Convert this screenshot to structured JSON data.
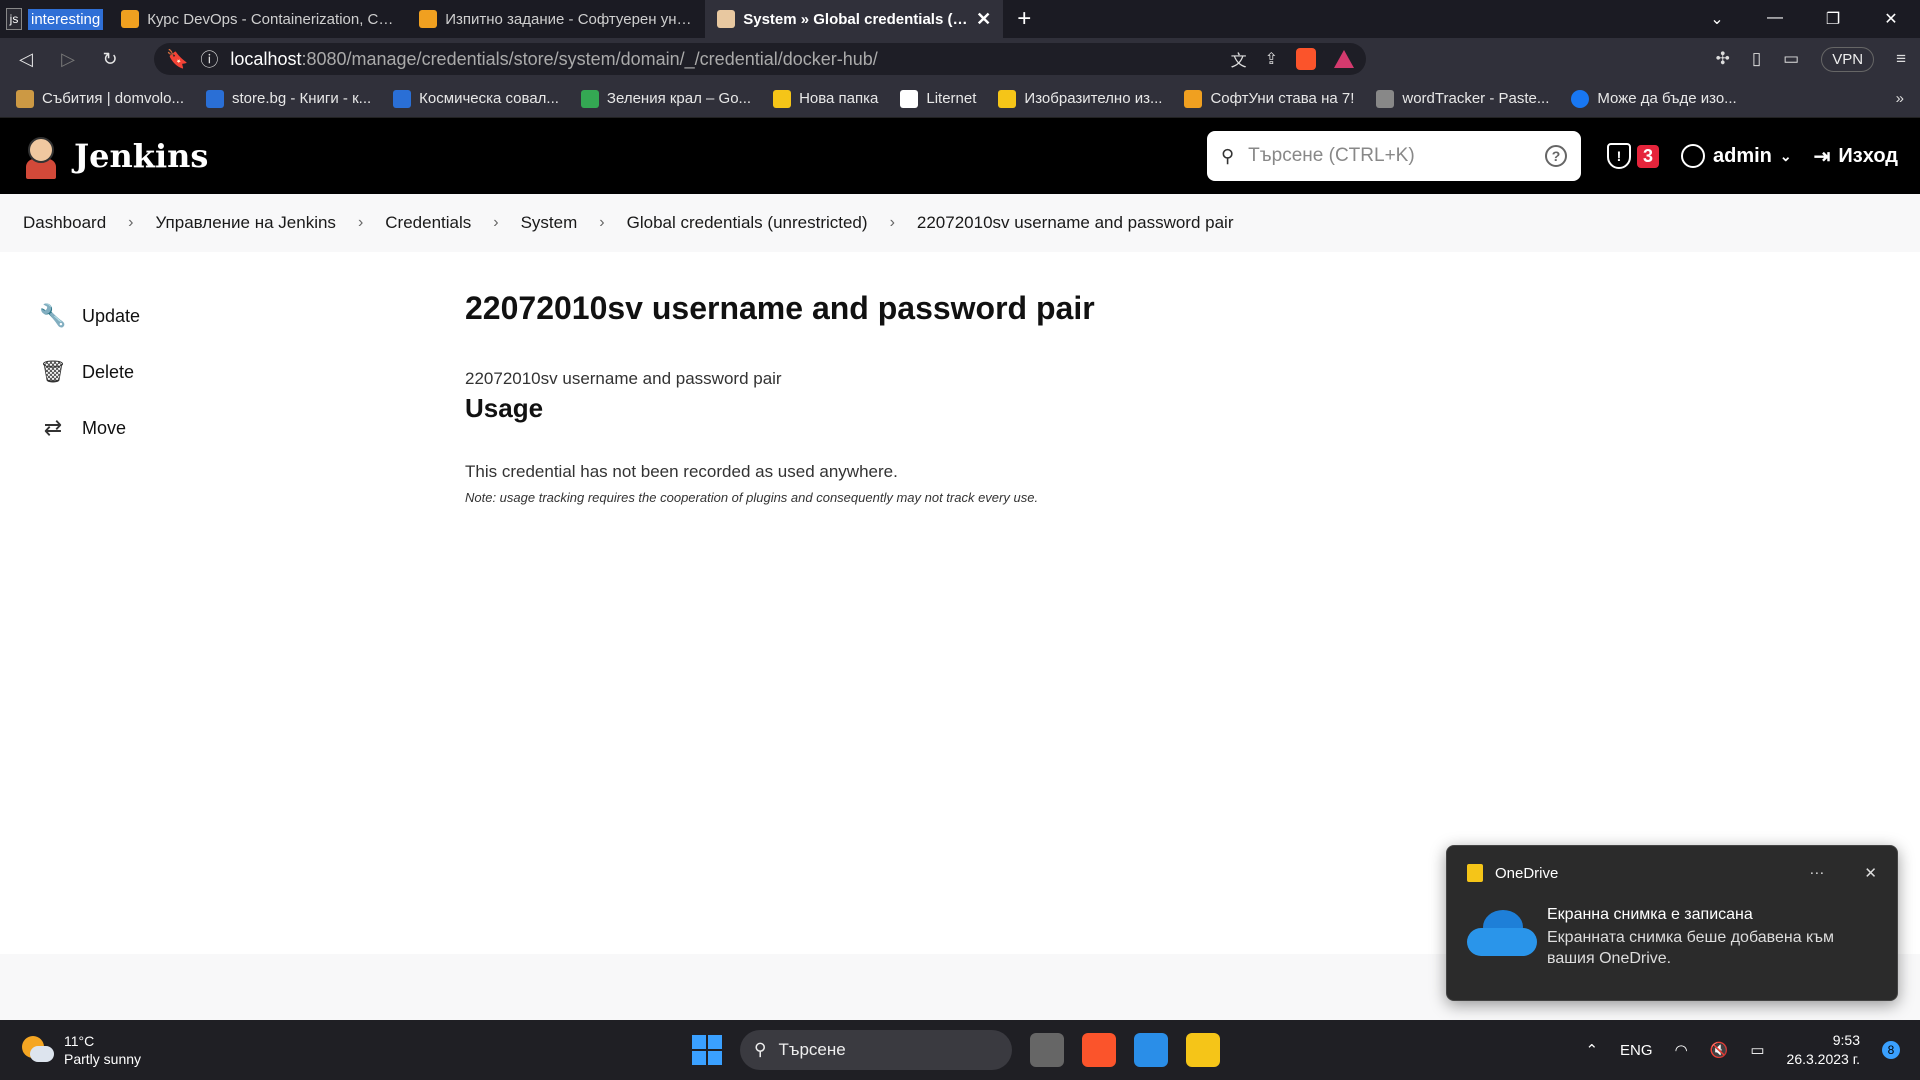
{
  "browser": {
    "pinned": [
      "js",
      "interesting"
    ],
    "tabs": [
      {
        "label": "Курс DevOps - Containerization, CI/CD",
        "icon_color": "#f0a020"
      },
      {
        "label": "Изпитно задание - Софтуерен униве",
        "icon_color": "#f0a020"
      },
      {
        "label": "System » Global credentials (unre",
        "icon_color": "#e8c8a0"
      }
    ],
    "url_host": "localhost",
    "url_path": ":8080/manage/credentials/store/system/domain/_/credential/docker-hub/",
    "vpn_label": "VPN",
    "bookmarks": [
      {
        "label": "Събития | domvolo...",
        "color": "#c94"
      },
      {
        "label": "store.bg - Книги - к...",
        "color": "#2a6fd6"
      },
      {
        "label": "Космическа совал...",
        "color": "#2a6fd6"
      },
      {
        "label": "Зеления крал – Go...",
        "color": "#34a853"
      },
      {
        "label": "Нова папка",
        "color": "#f5c518"
      },
      {
        "label": "Liternet",
        "color": "#fff"
      },
      {
        "label": "Изобразително из...",
        "color": "#f5c518"
      },
      {
        "label": "СофтУни става на 7!",
        "color": "#f0a020"
      },
      {
        "label": "wordTracker - Paste...",
        "color": "#888"
      },
      {
        "label": "Може да бъде изо...",
        "color": "#1877f2"
      }
    ]
  },
  "jenkins": {
    "logo_text": "Jenkins",
    "search_placeholder": "Търсене (CTRL+K)",
    "alert_count": "3",
    "user": "admin",
    "logout": "Изход"
  },
  "breadcrumbs": [
    "Dashboard",
    "Управление на Jenkins",
    "Credentials",
    "System",
    "Global credentials (unrestricted)",
    "22072010sv username and password pair"
  ],
  "sidebar": [
    {
      "label": "Update",
      "icon": "wrench-icon"
    },
    {
      "label": "Delete",
      "icon": "trash-icon"
    },
    {
      "label": "Move",
      "icon": "arrows-icon"
    }
  ],
  "main": {
    "title": "22072010sv username and password pair",
    "description": "22072010sv username and password pair",
    "usage_heading": "Usage",
    "usage_text": "This credential has not been recorded as used anywhere.",
    "usage_note": "Note: usage tracking requires the cooperation of plugins and consequently may not track every use."
  },
  "toast": {
    "app": "OneDrive",
    "more": "···",
    "close": "✕",
    "title": "Екранна снимка е записана",
    "body": "Екранната снимка беше добавена към вашия OneDrive."
  },
  "taskbar": {
    "temp": "11°C",
    "weather": "Partly sunny",
    "search": "Търсене",
    "lang": "ENG",
    "time": "9:53",
    "date": "26.3.2023 г.",
    "notifications": "8"
  }
}
